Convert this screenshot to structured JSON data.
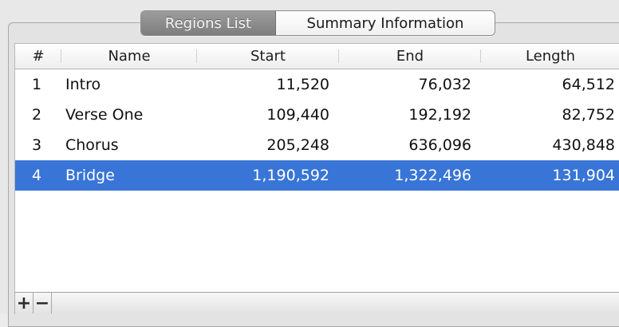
{
  "tabs": {
    "regions_label": "Regions List",
    "summary_label": "Summary Information"
  },
  "table": {
    "columns": [
      "#",
      "Name",
      "Start",
      "End",
      "Length"
    ],
    "rows": [
      {
        "num": "1",
        "name": "Intro",
        "start": "11,520",
        "end": "76,032",
        "length": "64,512"
      },
      {
        "num": "2",
        "name": "Verse One",
        "start": "109,440",
        "end": "192,192",
        "length": "82,752"
      },
      {
        "num": "3",
        "name": "Chorus",
        "start": "205,248",
        "end": "636,096",
        "length": "430,848"
      },
      {
        "num": "4",
        "name": "Bridge",
        "start": "1,190,592",
        "end": "1,322,496",
        "length": "131,904"
      }
    ],
    "selected_row": 4,
    "selection_color": "#3875d7"
  },
  "toolbar": {
    "add_label": "+",
    "remove_label": "−"
  }
}
